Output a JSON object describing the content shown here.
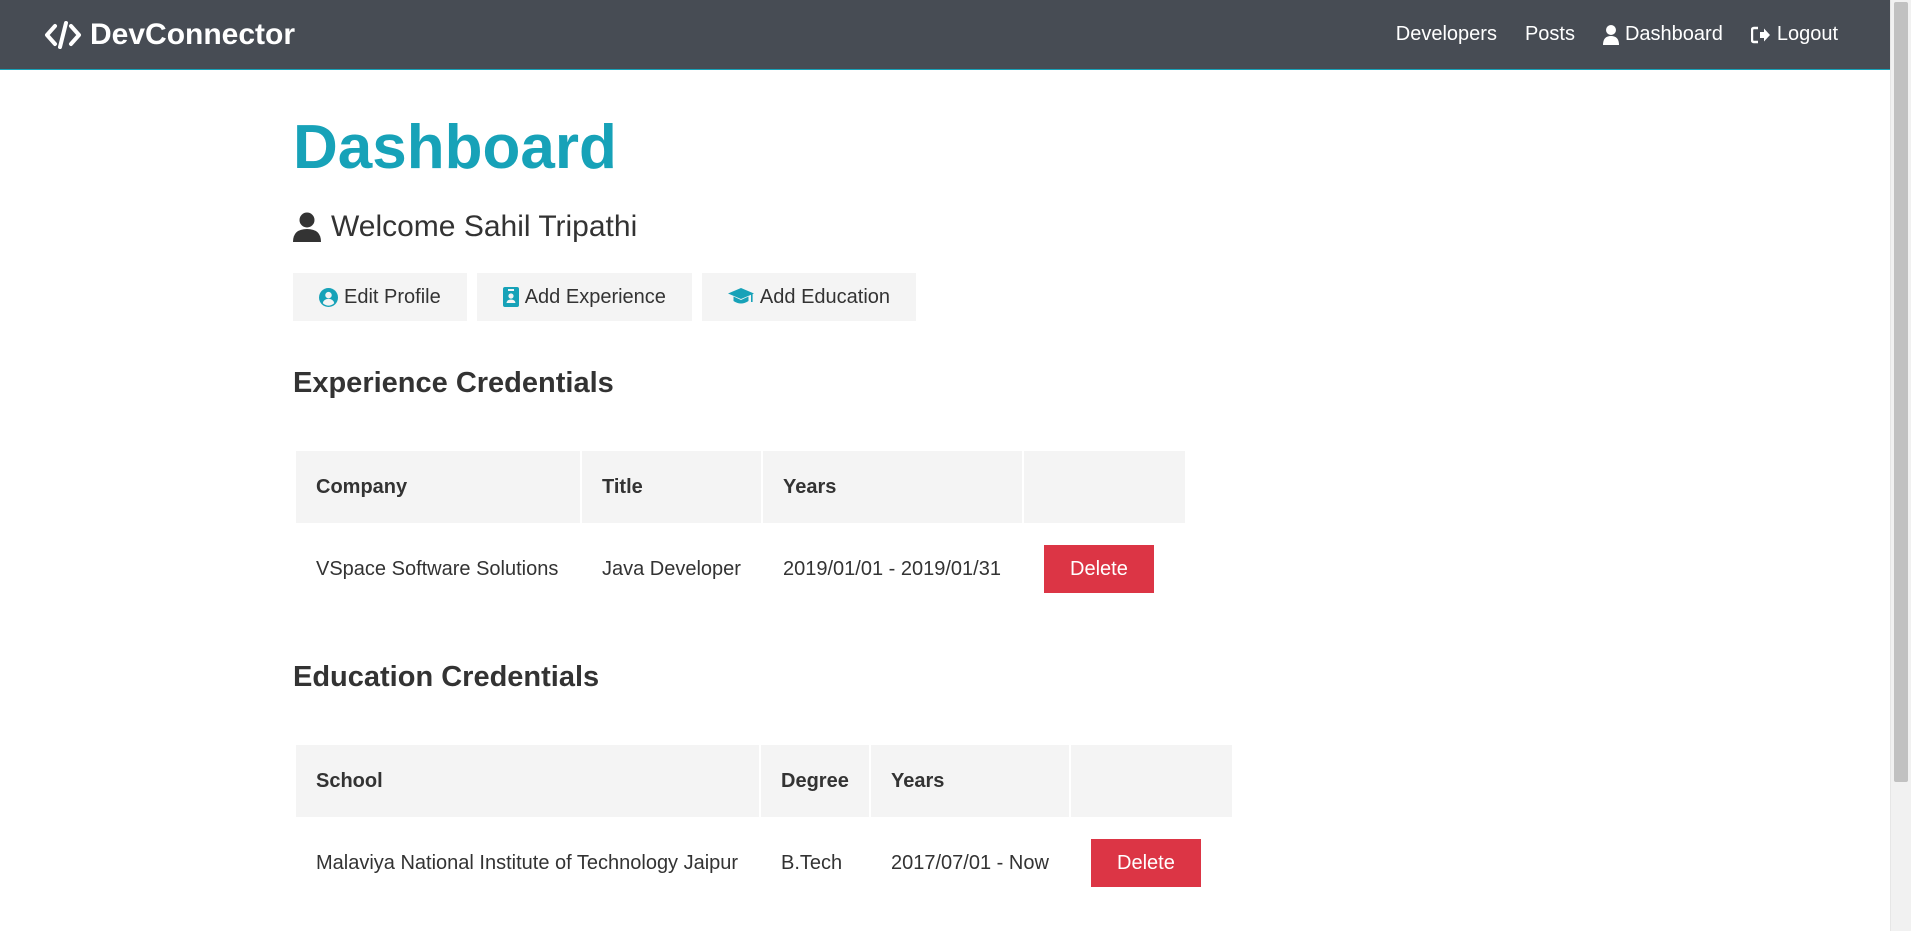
{
  "navbar": {
    "brand": "DevConnector",
    "links": [
      {
        "label": "Developers"
      },
      {
        "label": "Posts"
      },
      {
        "label": "Dashboard",
        "icon": "user-icon"
      },
      {
        "label": "Logout",
        "icon": "sign-out-icon"
      }
    ],
    "bg_color": "#474c54",
    "accent": "#17a2b8"
  },
  "page": {
    "title": "Dashboard",
    "welcome": "Welcome Sahil Tripathi",
    "buttons": [
      {
        "label": "Edit Profile",
        "icon": "user-circle-icon"
      },
      {
        "label": "Add Experience",
        "icon": "id-badge-icon"
      },
      {
        "label": "Add Education",
        "icon": "graduation-cap-icon"
      }
    ]
  },
  "experience": {
    "heading": "Experience Credentials",
    "columns": [
      "Company",
      "Title",
      "Years",
      ""
    ],
    "rows": [
      {
        "company": "VSpace Software Solutions",
        "title": "Java Developer",
        "years": "2019/01/01 - 2019/01/31",
        "action": "Delete"
      }
    ]
  },
  "education": {
    "heading": "Education Credentials",
    "columns": [
      "School",
      "Degree",
      "Years",
      ""
    ],
    "rows": [
      {
        "school": "Malaviya National Institute of Technology Jaipur",
        "degree": "B.Tech",
        "years": "2017/07/01 - Now",
        "action": "Delete"
      }
    ]
  },
  "colors": {
    "primary": "#17a2b8",
    "danger": "#dc3545",
    "light": "#f4f4f4"
  }
}
